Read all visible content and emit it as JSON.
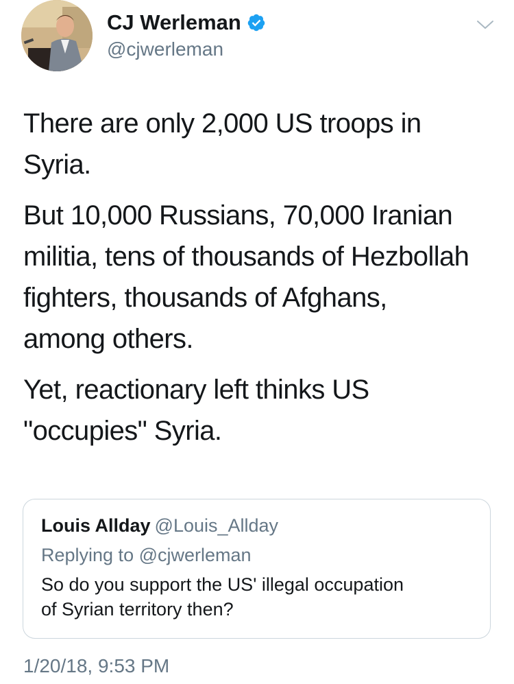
{
  "author": {
    "display_name": "CJ Werleman",
    "handle": "@cjwerleman",
    "verified": true,
    "avatar_icon": "avatar-photo"
  },
  "tweet": {
    "paragraphs": [
      "There are only 2,000 US troops in\nSyria.",
      "But 10,000 Russians, 70,000 Iranian\nmilitia, tens of thousands of Hezbollah\nfighters, thousands of Afghans,\namong others.",
      "Yet, reactionary left thinks US\n\"occupies\" Syria."
    ]
  },
  "quoted_tweet": {
    "display_name": "Louis Allday",
    "handle": "@Louis_Allday",
    "replying_to": "Replying to @cjwerleman",
    "text": "So do you support the US' illegal occupation\nof Syrian territory then?"
  },
  "timestamp": "1/20/18, 9:53 PM",
  "colors": {
    "verified_blue": "#1da1f2",
    "secondary_text": "#657786",
    "border": "#ccd6dd"
  },
  "icons": {
    "more": "chevron-down-icon",
    "verified": "verified-badge-icon"
  }
}
